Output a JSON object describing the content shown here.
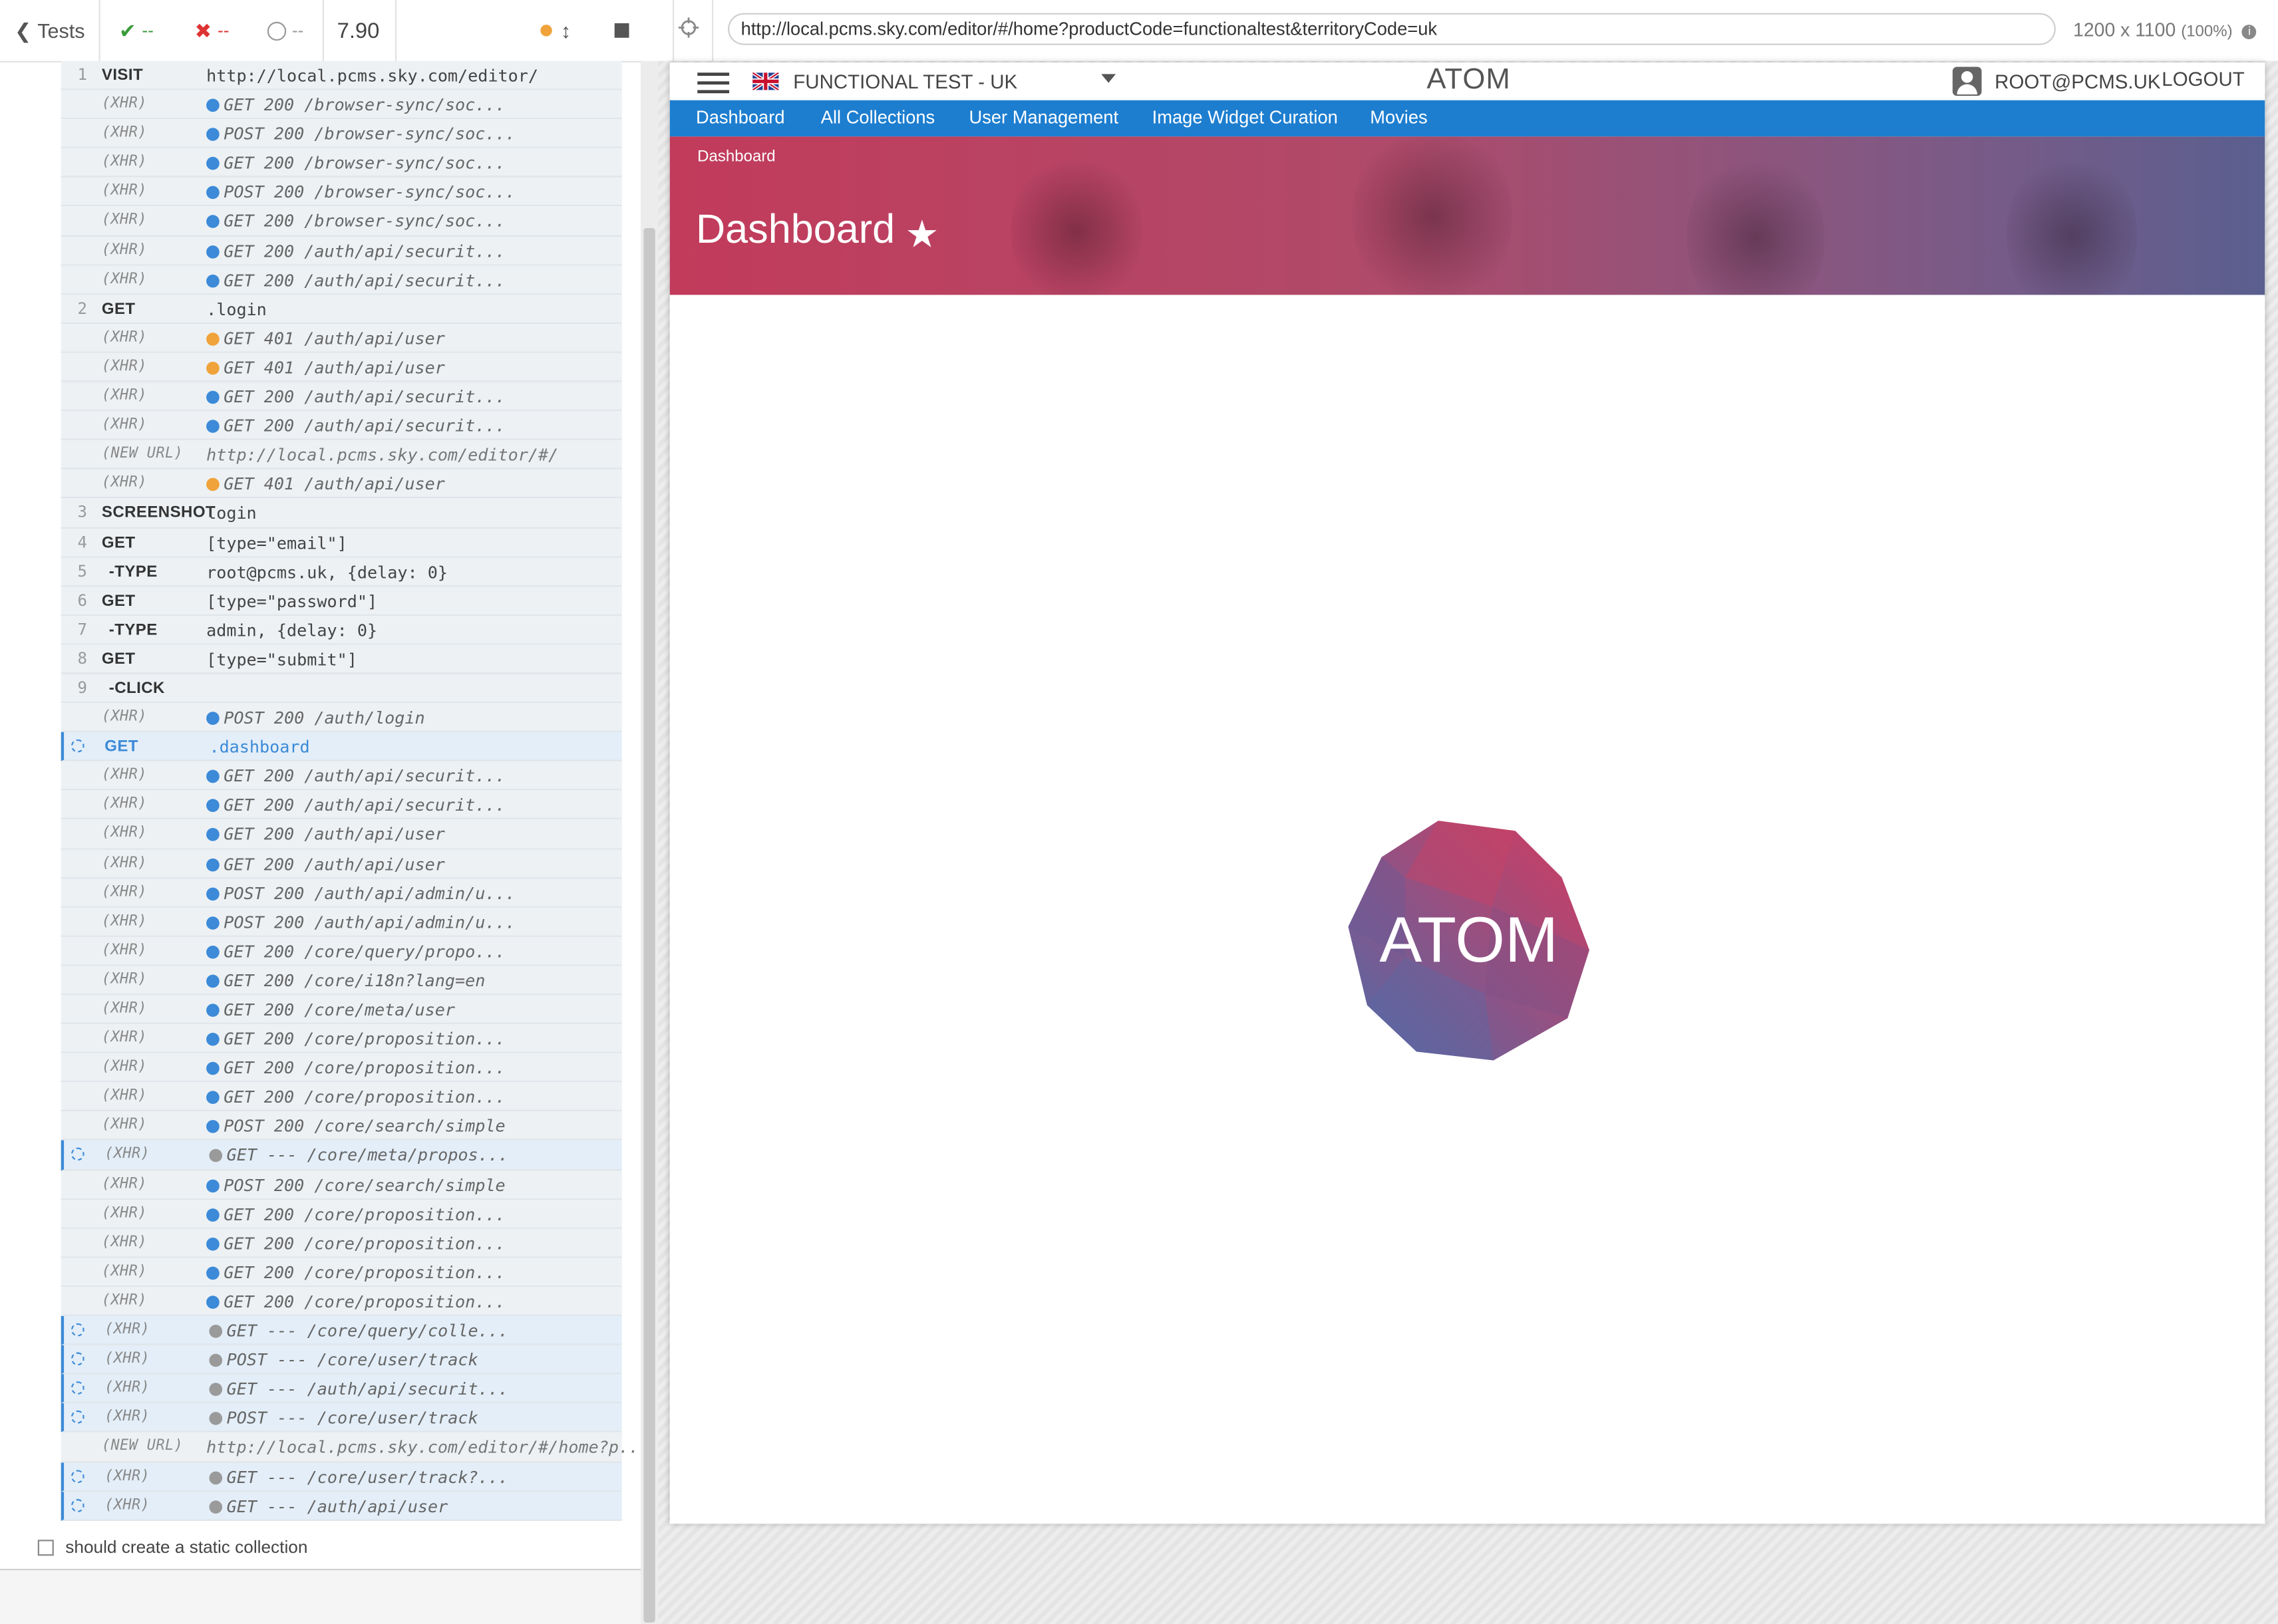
{
  "reporter": {
    "back_label": "Tests",
    "passed_count": "--",
    "failed_count": "--",
    "pending_count": "--",
    "duration": "7.90",
    "next_test_title": "should create a static collection",
    "colors": {
      "xhr_ok": "#3c8ad8",
      "xhr_401": "#f0a33a",
      "xhr_pending": "#9a9a9a"
    },
    "commands": [
      {
        "num": "1",
        "cmd": "VISIT",
        "msg": "http://local.pcms.sky.com/editor/",
        "kind": "cmd"
      },
      {
        "num": "",
        "cmd": "(XHR)",
        "msg": "GET 200 /browser-sync/soc...",
        "kind": "xhr",
        "dot": "ok"
      },
      {
        "num": "",
        "cmd": "(XHR)",
        "msg": "POST 200 /browser-sync/soc...",
        "kind": "xhr",
        "dot": "ok"
      },
      {
        "num": "",
        "cmd": "(XHR)",
        "msg": "GET 200 /browser-sync/soc...",
        "kind": "xhr",
        "dot": "ok"
      },
      {
        "num": "",
        "cmd": "(XHR)",
        "msg": "POST 200 /browser-sync/soc...",
        "kind": "xhr",
        "dot": "ok"
      },
      {
        "num": "",
        "cmd": "(XHR)",
        "msg": "GET 200 /browser-sync/soc...",
        "kind": "xhr",
        "dot": "ok"
      },
      {
        "num": "",
        "cmd": "(XHR)",
        "msg": "GET 200 /auth/api/securit...",
        "kind": "xhr",
        "dot": "ok"
      },
      {
        "num": "",
        "cmd": "(XHR)",
        "msg": "GET 200 /auth/api/securit...",
        "kind": "xhr",
        "dot": "ok"
      },
      {
        "num": "2",
        "cmd": "GET",
        "msg": ".login",
        "kind": "cmd"
      },
      {
        "num": "",
        "cmd": "(XHR)",
        "msg": "GET 401 /auth/api/user",
        "kind": "xhr",
        "dot": "warn"
      },
      {
        "num": "",
        "cmd": "(XHR)",
        "msg": "GET 401 /auth/api/user",
        "kind": "xhr",
        "dot": "warn"
      },
      {
        "num": "",
        "cmd": "(XHR)",
        "msg": "GET 200 /auth/api/securit...",
        "kind": "xhr",
        "dot": "ok"
      },
      {
        "num": "",
        "cmd": "(XHR)",
        "msg": "GET 200 /auth/api/securit...",
        "kind": "xhr",
        "dot": "ok"
      },
      {
        "num": "",
        "cmd": "(NEW URL)",
        "msg": "http://local.pcms.sky.com/editor/#/",
        "kind": "newurl"
      },
      {
        "num": "",
        "cmd": "(XHR)",
        "msg": "GET 401 /auth/api/user",
        "kind": "xhr",
        "dot": "warn"
      },
      {
        "num": "3",
        "cmd": "SCREENSHOT",
        "msg": "login",
        "kind": "cmd"
      },
      {
        "num": "4",
        "cmd": "GET",
        "msg": "[type=\"email\"]",
        "kind": "cmd"
      },
      {
        "num": "5",
        "cmd": "-TYPE",
        "msg": "root@pcms.uk, {delay: 0}",
        "kind": "child"
      },
      {
        "num": "6",
        "cmd": "GET",
        "msg": "[type=\"password\"]",
        "kind": "cmd"
      },
      {
        "num": "7",
        "cmd": "-TYPE",
        "msg": "admin, {delay: 0}",
        "kind": "child"
      },
      {
        "num": "8",
        "cmd": "GET",
        "msg": "[type=\"submit\"]",
        "kind": "cmd"
      },
      {
        "num": "9",
        "cmd": "-CLICK",
        "msg": "",
        "kind": "child"
      },
      {
        "num": "",
        "cmd": "(XHR)",
        "msg": "POST 200 /auth/login",
        "kind": "xhr",
        "dot": "ok"
      },
      {
        "num": "",
        "cmd": "GET",
        "msg": ".dashboard",
        "kind": "active"
      },
      {
        "num": "",
        "cmd": "(XHR)",
        "msg": "GET 200 /auth/api/securit...",
        "kind": "xhr",
        "dot": "ok"
      },
      {
        "num": "",
        "cmd": "(XHR)",
        "msg": "GET 200 /auth/api/securit...",
        "kind": "xhr",
        "dot": "ok"
      },
      {
        "num": "",
        "cmd": "(XHR)",
        "msg": "GET 200 /auth/api/user",
        "kind": "xhr",
        "dot": "ok"
      },
      {
        "num": "",
        "cmd": "(XHR)",
        "msg": "GET 200 /auth/api/user",
        "kind": "xhr",
        "dot": "ok"
      },
      {
        "num": "",
        "cmd": "(XHR)",
        "msg": "POST 200 /auth/api/admin/u...",
        "kind": "xhr",
        "dot": "ok"
      },
      {
        "num": "",
        "cmd": "(XHR)",
        "msg": "POST 200 /auth/api/admin/u...",
        "kind": "xhr",
        "dot": "ok"
      },
      {
        "num": "",
        "cmd": "(XHR)",
        "msg": "GET 200 /core/query/propo...",
        "kind": "xhr",
        "dot": "ok"
      },
      {
        "num": "",
        "cmd": "(XHR)",
        "msg": "GET 200 /core/i18n?lang=en",
        "kind": "xhr",
        "dot": "ok"
      },
      {
        "num": "",
        "cmd": "(XHR)",
        "msg": "GET 200 /core/meta/user",
        "kind": "xhr",
        "dot": "ok"
      },
      {
        "num": "",
        "cmd": "(XHR)",
        "msg": "GET 200 /core/proposition...",
        "kind": "xhr",
        "dot": "ok"
      },
      {
        "num": "",
        "cmd": "(XHR)",
        "msg": "GET 200 /core/proposition...",
        "kind": "xhr",
        "dot": "ok"
      },
      {
        "num": "",
        "cmd": "(XHR)",
        "msg": "GET 200 /core/proposition...",
        "kind": "xhr",
        "dot": "ok"
      },
      {
        "num": "",
        "cmd": "(XHR)",
        "msg": "POST 200 /core/search/simple",
        "kind": "xhr",
        "dot": "ok"
      },
      {
        "num": "",
        "cmd": "(XHR)",
        "msg": "GET --- /core/meta/propos...",
        "kind": "xhrpending",
        "dot": "pending"
      },
      {
        "num": "",
        "cmd": "(XHR)",
        "msg": "POST 200 /core/search/simple",
        "kind": "xhr",
        "dot": "ok"
      },
      {
        "num": "",
        "cmd": "(XHR)",
        "msg": "GET 200 /core/proposition...",
        "kind": "xhr",
        "dot": "ok"
      },
      {
        "num": "",
        "cmd": "(XHR)",
        "msg": "GET 200 /core/proposition...",
        "kind": "xhr",
        "dot": "ok"
      },
      {
        "num": "",
        "cmd": "(XHR)",
        "msg": "GET 200 /core/proposition...",
        "kind": "xhr",
        "dot": "ok"
      },
      {
        "num": "",
        "cmd": "(XHR)",
        "msg": "GET 200 /core/proposition...",
        "kind": "xhr",
        "dot": "ok"
      },
      {
        "num": "",
        "cmd": "(XHR)",
        "msg": "GET --- /core/query/colle...",
        "kind": "xhrpending",
        "dot": "pending"
      },
      {
        "num": "",
        "cmd": "(XHR)",
        "msg": "POST --- /core/user/track",
        "kind": "xhrpending",
        "dot": "pending"
      },
      {
        "num": "",
        "cmd": "(XHR)",
        "msg": "GET --- /auth/api/securit...",
        "kind": "xhrpending",
        "dot": "pending"
      },
      {
        "num": "",
        "cmd": "(XHR)",
        "msg": "POST --- /core/user/track",
        "kind": "xhrpending",
        "dot": "pending"
      },
      {
        "num": "",
        "cmd": "(NEW URL)",
        "msg": "http://local.pcms.sky.com/editor/#/home?p...",
        "kind": "newurl"
      },
      {
        "num": "",
        "cmd": "(XHR)",
        "msg": "GET --- /core/user/track?...",
        "kind": "xhrpending",
        "dot": "pending"
      },
      {
        "num": "",
        "cmd": "(XHR)",
        "msg": "GET --- /auth/api/user",
        "kind": "xhrpending",
        "dot": "pending"
      }
    ]
  },
  "aut": {
    "url": "http://local.pcms.sky.com/editor/#/home?productCode=functionaltest&territoryCode=uk",
    "viewport_size": "1200 x 1100",
    "viewport_scale": "(100%)"
  },
  "app": {
    "territory_label": "FUNCTIONAL TEST - UK",
    "logo_text": "ATOM",
    "user_label": "ROOT@PCMS.UK",
    "logout_label": "LOGOUT",
    "nav_items": [
      "Dashboard",
      "All Collections",
      "User Management",
      "Image Widget Curation",
      "Movies"
    ],
    "breadcrumb": "Dashboard",
    "page_title": "Dashboard",
    "brand_colors": {
      "nav_blue": "#1d7ed0",
      "hero_red": "#c23b5b",
      "hero_purple": "#5a5f8f"
    }
  }
}
